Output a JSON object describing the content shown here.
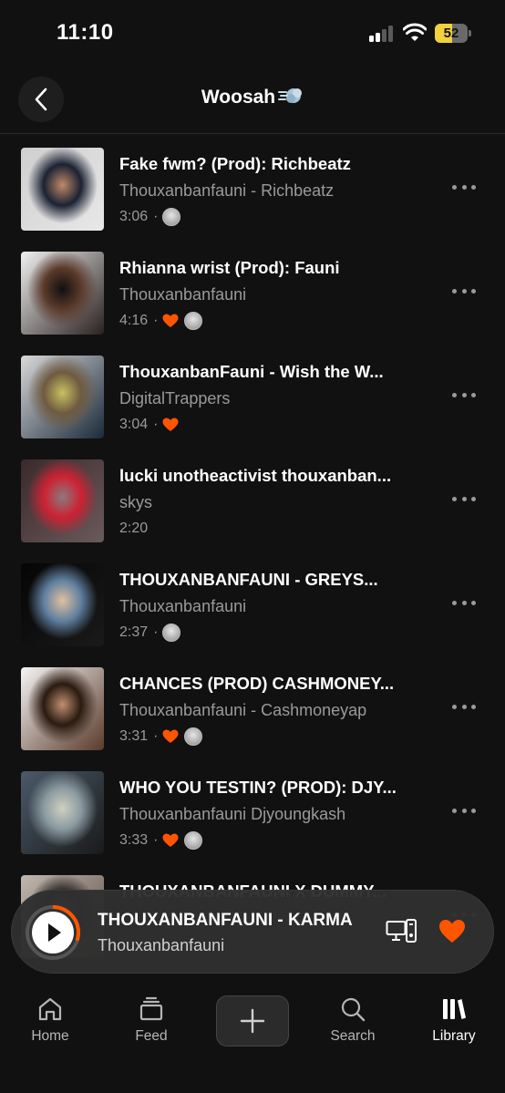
{
  "status_bar": {
    "time": "11:10",
    "battery": "52",
    "battery_level": 0.52
  },
  "header": {
    "title": "Woosah",
    "title_icon": "dash-icon"
  },
  "tracks": [
    {
      "title": "Fake fwm? (Prod): Richbeatz",
      "artist": "Thouxanbanfauni - Richbeatz",
      "duration": "3:06",
      "liked": false,
      "avatar": true,
      "thumb_colors": [
        "#cfcfcf",
        "#e8e8e8",
        "#1b2233",
        "#c08a6a"
      ]
    },
    {
      "title": "Rhianna wrist (Prod): Fauni",
      "artist": "Thouxanbanfauni",
      "duration": "4:16",
      "liked": true,
      "avatar": true,
      "thumb_colors": [
        "#f0f0f0",
        "#2a2020",
        "#5a3a2a",
        "#101010"
      ]
    },
    {
      "title": "ThouxanbanFauni - Wish the W...",
      "artist": "DigitalTrappers",
      "duration": "3:04",
      "liked": true,
      "avatar": false,
      "thumb_colors": [
        "#d9d9d9",
        "#1a2a3a",
        "#6f5a40",
        "#c8c060"
      ]
    },
    {
      "title": "lucki unotheactivist thouxanban...",
      "artist": "skys",
      "duration": "2:20",
      "liked": false,
      "avatar": false,
      "thumb_colors": [
        "#3a2a2c",
        "#6a5a5c",
        "#cc2233",
        "#8a7a7c"
      ]
    },
    {
      "title": "THOUXANBANFAUNI - GREYS...",
      "artist": "Thouxanbanfauni",
      "duration": "2:37",
      "liked": false,
      "avatar": true,
      "thumb_colors": [
        "#050505",
        "#1a1a1a",
        "#6080a0",
        "#e0c0a0"
      ]
    },
    {
      "title": "CHANCES (PROD) CASHMONEY...",
      "artist": "Thouxanbanfauni - Cashmoneyap",
      "duration": "3:31",
      "liked": true,
      "avatar": true,
      "thumb_colors": [
        "#f5f5f5",
        "#5a3a2a",
        "#2a1a10",
        "#c09070"
      ]
    },
    {
      "title": "WHO YOU TESTIN? (PROD): DJY...",
      "artist": "Thouxanbanfauni Djyoungkash",
      "duration": "3:33",
      "liked": true,
      "avatar": true,
      "thumb_colors": [
        "#4a5a6a",
        "#1a1a1a",
        "#8a9aa0",
        "#d0d0c0"
      ]
    },
    {
      "title": "THOUXANBANFAUNI X DUMMY...",
      "artist": "",
      "duration": "",
      "liked": false,
      "avatar": false,
      "thumb_colors": [
        "#c0b8b0",
        "#5a4a40",
        "#2a2220",
        "#e0d8d0"
      ]
    }
  ],
  "now_playing": {
    "title": "THOUXANBANFAUNI - KARMA",
    "artist": "Thouxanbanfauni",
    "progress": 0.3
  },
  "tabs": [
    {
      "label": "Home",
      "icon": "home-icon",
      "active": false
    },
    {
      "label": "Feed",
      "icon": "feed-icon",
      "active": false
    },
    {
      "label": "",
      "icon": "plus-icon",
      "active": false
    },
    {
      "label": "Search",
      "icon": "search-icon",
      "active": false
    },
    {
      "label": "Library",
      "icon": "library-icon",
      "active": true
    }
  ],
  "colors": {
    "accent": "#ff5500",
    "background": "#111111",
    "secondary_text": "#9a9a9a"
  }
}
